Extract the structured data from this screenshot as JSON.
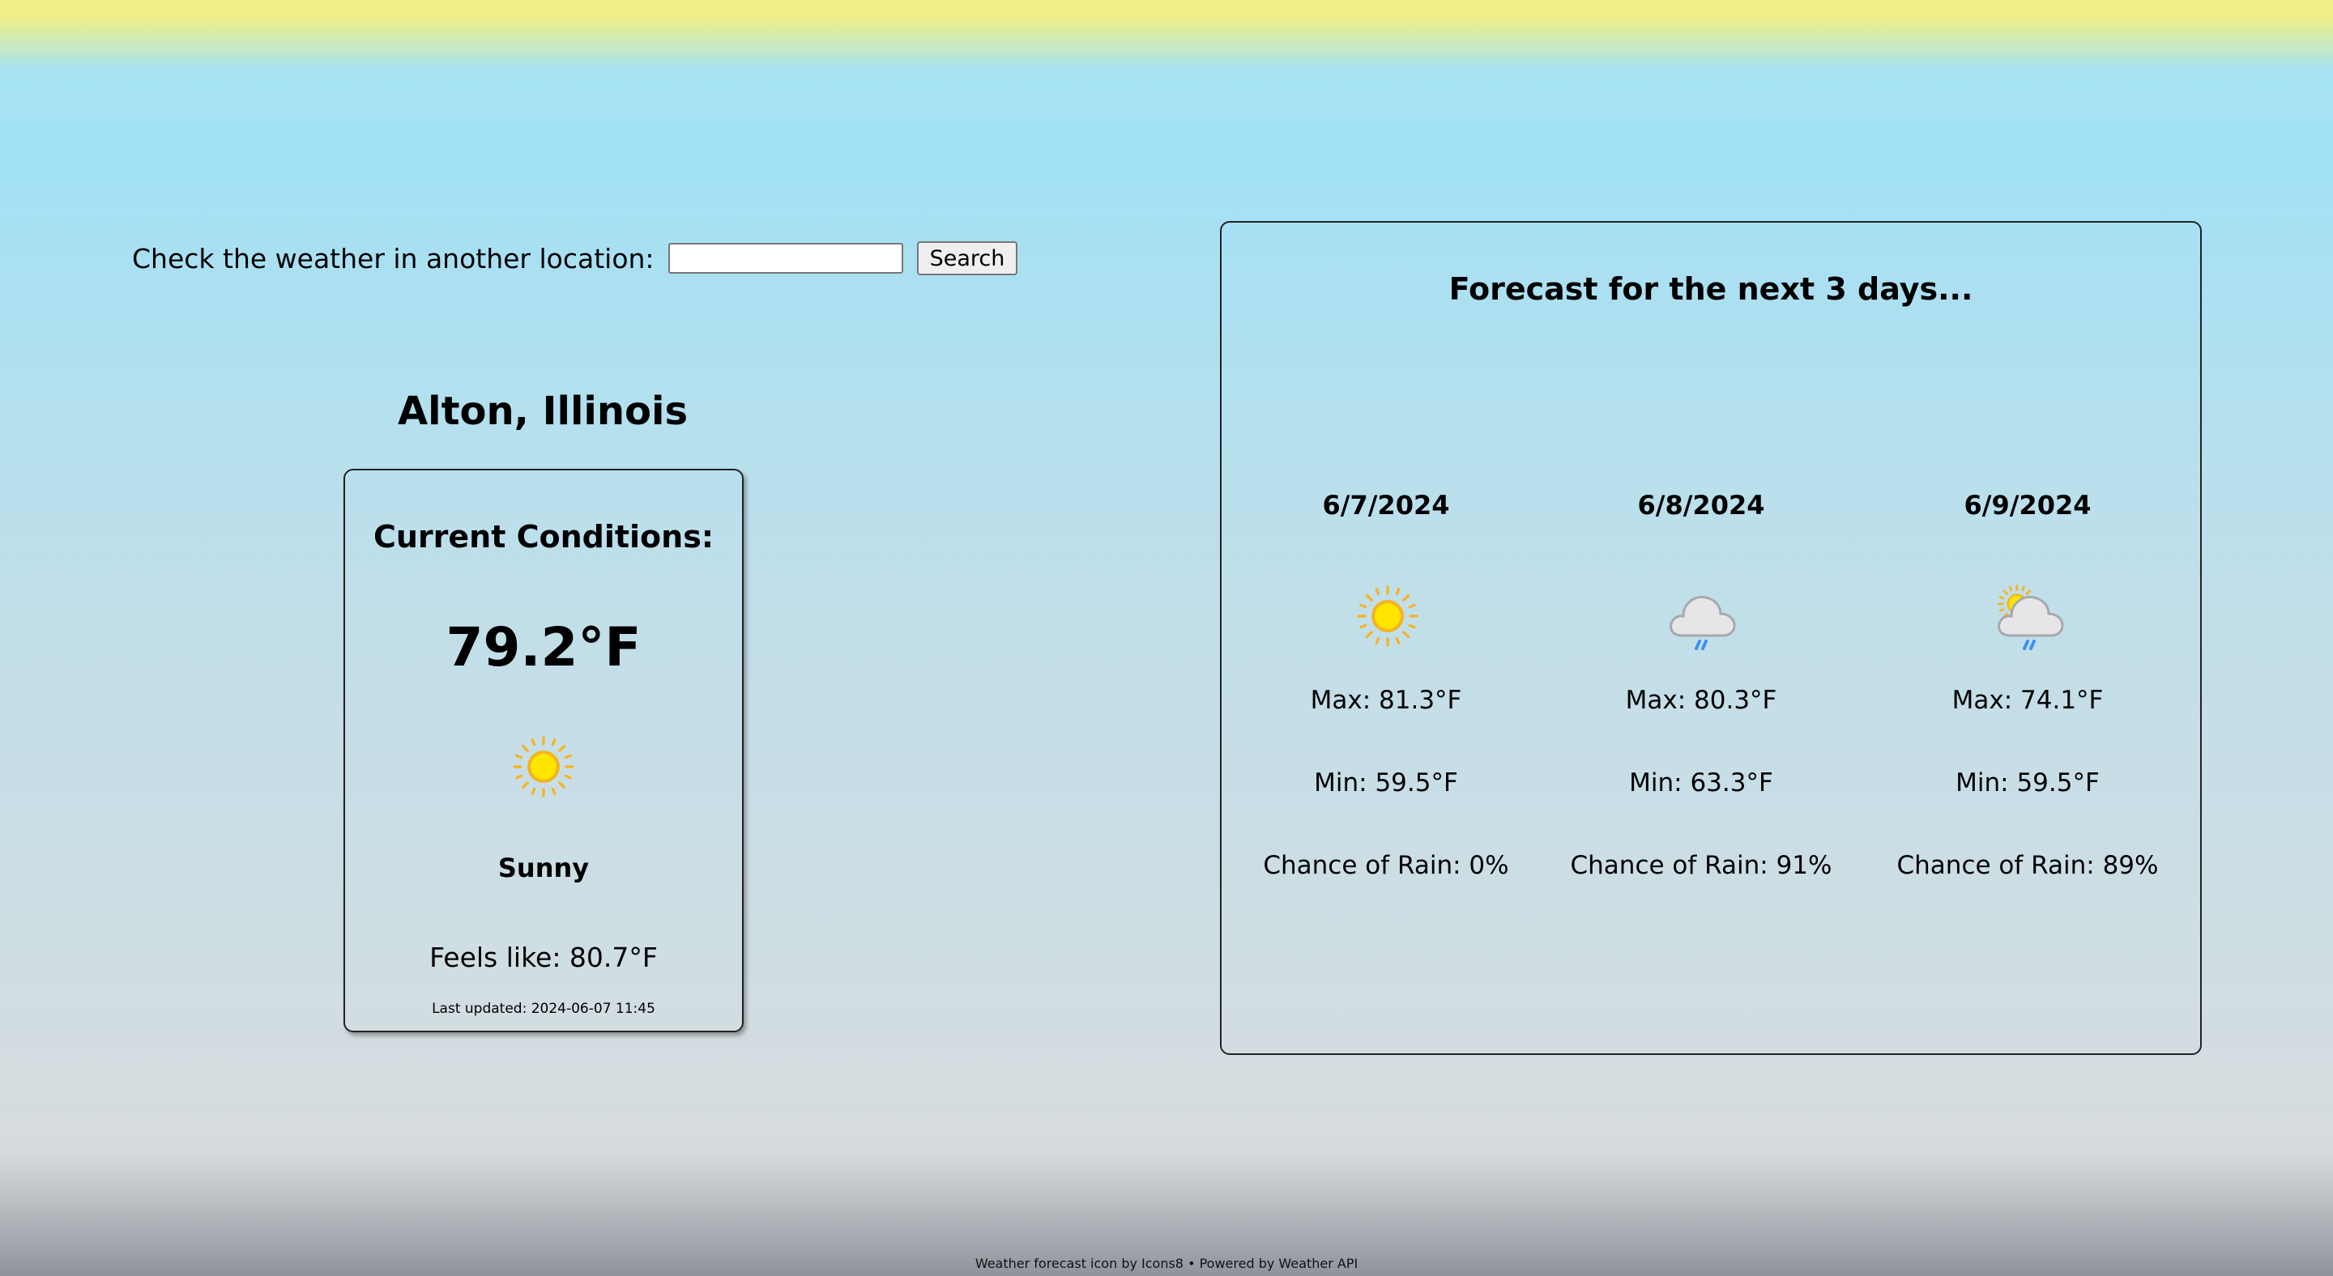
{
  "search": {
    "label": "Check the weather in another location:",
    "input_value": "",
    "placeholder": "",
    "button_label": "Search"
  },
  "location": {
    "title": "Alton, Illinois"
  },
  "current": {
    "heading": "Current Conditions:",
    "temperature": "79.2°F",
    "icon": "sun-icon",
    "condition": "Sunny",
    "feels_like": "Feels like: 80.7°F",
    "last_updated": "Last updated: 2024-06-07 11:45"
  },
  "forecast": {
    "heading": "Forecast for the next 3 days...",
    "days": [
      {
        "date": "6/7/2024",
        "icon": "sun-icon",
        "max": "Max: 81.3°F",
        "min": "Min: 59.5°F",
        "rain": "Chance of Rain: 0%"
      },
      {
        "date": "6/8/2024",
        "icon": "rain-cloud-icon",
        "max": "Max: 80.3°F",
        "min": "Min: 63.3°F",
        "rain": "Chance of Rain: 91%"
      },
      {
        "date": "6/9/2024",
        "icon": "sun-cloud-rain-icon",
        "max": "Max: 74.1°F",
        "min": "Min: 59.5°F",
        "rain": "Chance of Rain: 89%"
      }
    ]
  },
  "footer": {
    "text": "Weather forecast icon by Icons8 • Powered by Weather API"
  },
  "colors": {
    "sun_core": "#ffe500",
    "sun_ring": "#f5b321",
    "cloud_fill": "#e6e6e8",
    "cloud_stroke": "#a6a9ad",
    "rain": "#3d8ef5"
  }
}
